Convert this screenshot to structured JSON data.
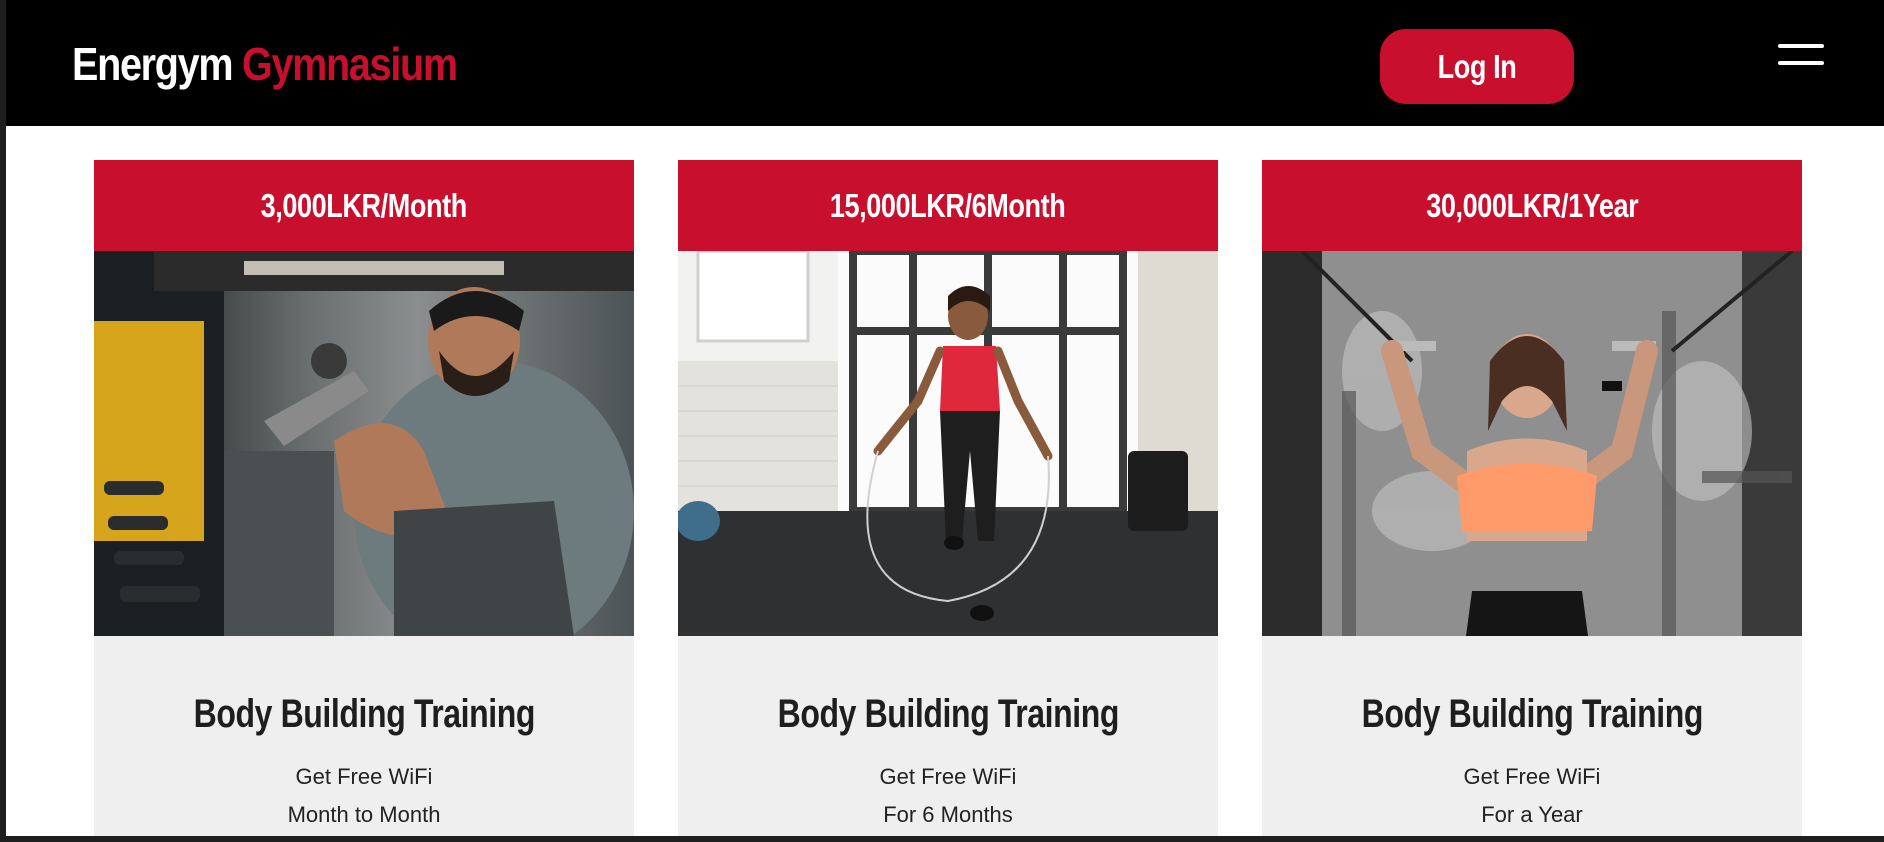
{
  "brand": {
    "part1": "Energym",
    "part2": "Gymnasium"
  },
  "nav": {
    "login_label": "Log In",
    "menu_icon": "hamburger-menu-icon"
  },
  "colors": {
    "accent": "#c8102e",
    "header_bg": "#000000",
    "card_bg": "#efefef"
  },
  "plans": [
    {
      "price": "3,000LKR/Month",
      "photo": "man-doing-bicep-curls",
      "title": "Body Building Training",
      "features": [
        "Get Free WiFi",
        "Month to Month"
      ]
    },
    {
      "price": "15,000LKR/6Month",
      "photo": "woman-jumping-rope",
      "title": "Body Building Training",
      "features": [
        "Get Free WiFi",
        "For 6 Months"
      ]
    },
    {
      "price": "30,000LKR/1Year",
      "photo": "woman-cable-pulldown",
      "title": "Body Building Training",
      "features": [
        "Get Free WiFi",
        "For a Year"
      ]
    }
  ]
}
